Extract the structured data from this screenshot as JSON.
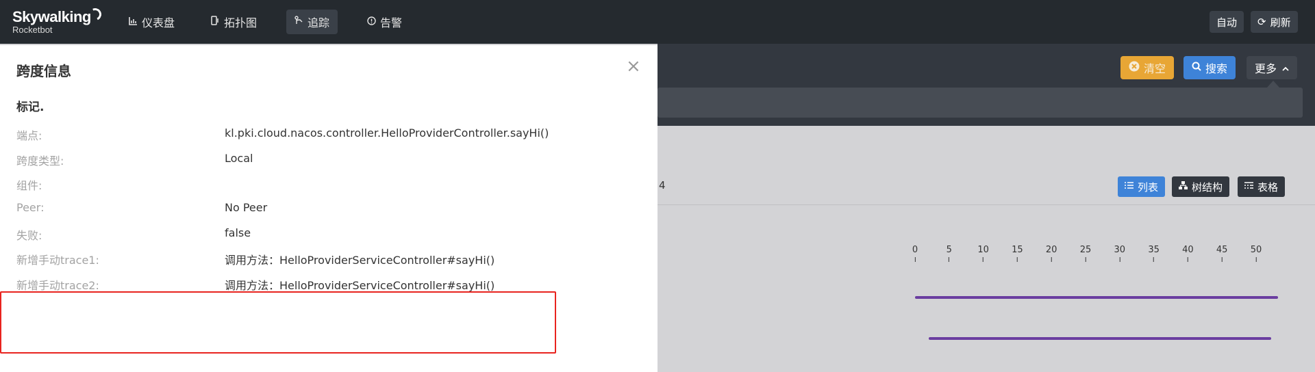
{
  "header": {
    "brand": "Skywalking",
    "brand_sub": "Rocketbot",
    "nav": [
      {
        "icon": "dashboard-icon",
        "glyph": "📈",
        "label": "仪表盘"
      },
      {
        "icon": "topology-icon",
        "glyph": "◨",
        "label": "拓扑图"
      },
      {
        "icon": "trace-icon",
        "glyph": "↳",
        "label": "追踪"
      },
      {
        "icon": "alarm-icon",
        "glyph": "⊙",
        "label": "告警"
      }
    ],
    "auto_label": "自动",
    "refresh_label": "刷新"
  },
  "toolbar": {
    "clear_label": "清空",
    "search_label": "搜索",
    "more_label": "更多"
  },
  "trace": {
    "stat_fragment": "4",
    "view_list_label": "列表",
    "view_tree_label": "树结构",
    "view_table_label": "表格",
    "axis_ticks": [
      "0",
      "5",
      "10",
      "15",
      "20",
      "25",
      "30",
      "35",
      "40",
      "45",
      "50"
    ]
  },
  "drawer": {
    "title": "跨度信息",
    "section_title": "标记.",
    "rows": [
      {
        "key": "端点:",
        "value": "kl.pki.cloud.nacos.controller.HelloProviderController.sayHi()"
      },
      {
        "key": "跨度类型:",
        "value": "Local"
      },
      {
        "key": "组件:",
        "value": ""
      },
      {
        "key": "Peer:",
        "value": "No Peer"
      },
      {
        "key": "失败:",
        "value": "false"
      },
      {
        "key": "新增手动trace1:",
        "value": "调用方法：HelloProviderServiceController#sayHi()"
      },
      {
        "key": "新增手动trace2:",
        "value": "调用方法：HelloProviderServiceController#sayHi()"
      }
    ]
  },
  "colors": {
    "highlight_border": "#e8231e",
    "timeline_bar": "#6a3da0",
    "accent_blue": "#3e83d8",
    "accent_orange": "#e8a635"
  }
}
